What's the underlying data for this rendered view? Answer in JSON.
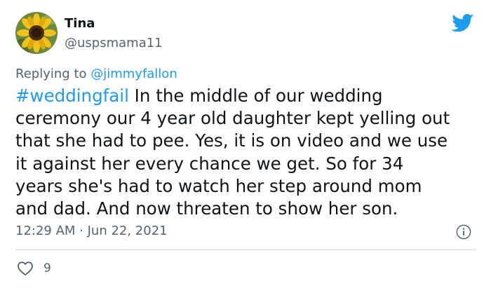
{
  "author": {
    "display_name": "Tina",
    "handle": "@uspsmama11",
    "avatar_icon": "sunflower-avatar"
  },
  "brand": {
    "icon": "twitter-bird-icon",
    "color": "#1d9bf0"
  },
  "reply": {
    "prefix": "Replying to",
    "mention": "@jimmyfallon"
  },
  "tweet": {
    "hashtag": "#weddingfail",
    "line1_rest": " In the middle of our wedding",
    "line2": "ceremony our 4 year old daughter kept yelling out",
    "line3": "that she had to pee.  Yes, it is on video and we use",
    "line4": "it against her every chance we get.  So for 34",
    "line5": "years she's had to watch her step around mom",
    "line6": "and dad.  And now threaten to show her son."
  },
  "meta": {
    "timestamp": "12:29 AM · Jun 22, 2021",
    "info_icon": "info-icon"
  },
  "engagement": {
    "like_icon": "heart-icon",
    "like_count": "9"
  },
  "colors": {
    "text": "#0f1419",
    "secondary": "#536471",
    "link": "#1d9bf0",
    "divider": "#cfd9de"
  }
}
